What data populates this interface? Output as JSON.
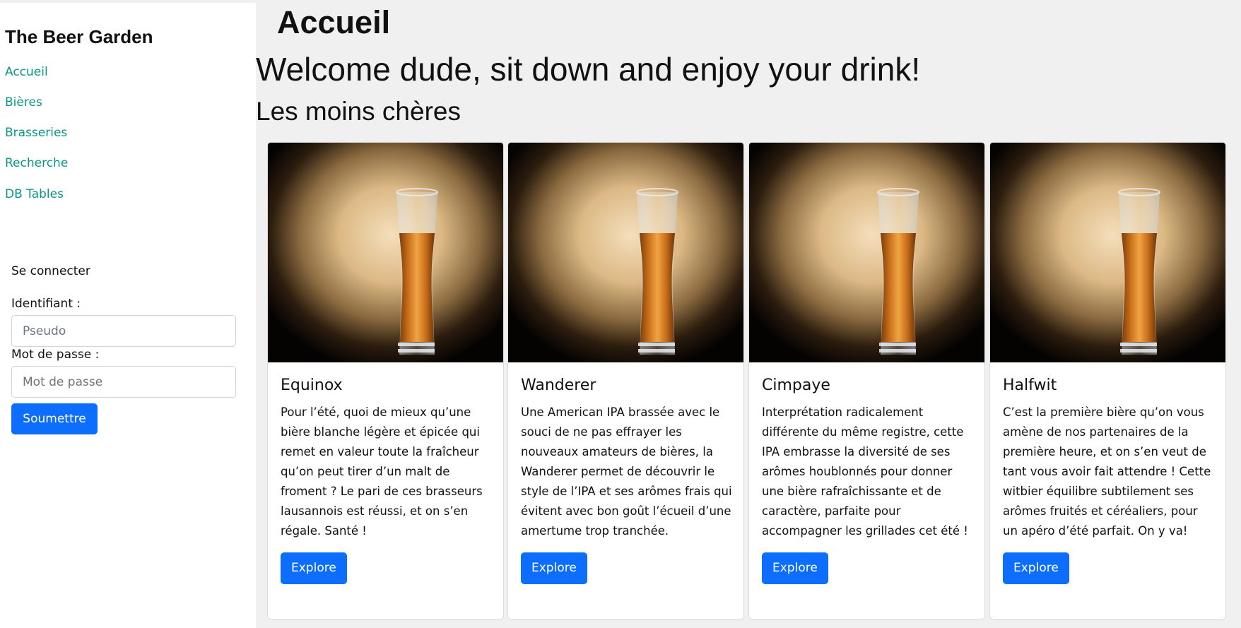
{
  "sidebar": {
    "brand": "The Beer Garden",
    "nav": [
      {
        "label": "Accueil"
      },
      {
        "label": "Bières"
      },
      {
        "label": "Brasseries"
      },
      {
        "label": "Recherche"
      },
      {
        "label": "DB Tables"
      }
    ],
    "login": {
      "title": "Se connecter",
      "username_label": "Identifiant :",
      "username_placeholder": "Pseudo",
      "password_label": "Mot de passe :",
      "password_placeholder": "Mot de passe",
      "submit_label": "Soumettre"
    }
  },
  "main": {
    "page_title": "Accueil",
    "welcome": "Welcome dude, sit down and enjoy your drink!",
    "section_title": "Les moins chères",
    "cards": [
      {
        "title": "Equinox",
        "text": "Pour l’été, quoi de mieux qu’une bière blanche légère et épicée qui remet en valeur toute la fraîcheur qu’on peut tirer d’un malt de froment ? Le pari de ces brasseurs lausannois est réussi, et on s’en régale. Santé !",
        "button": "Explore"
      },
      {
        "title": "Wanderer",
        "text": "Une American IPA brassée avec le souci de ne pas effrayer les nouveaux amateurs de bières, la Wanderer permet de découvrir le style de l’IPA et ses arômes frais qui évitent avec bon goût l’écueil d’une amertume trop tranchée.",
        "button": "Explore"
      },
      {
        "title": "Cimpaye",
        "text": "Interprétation radicalement différente du même registre, cette IPA embrasse la diversité de ses arômes houblonnés pour donner une bière rafraîchissante et de caractère, parfaite pour accompagner les grillades cet été !",
        "button": "Explore"
      },
      {
        "title": "Halfwit",
        "text": "C’est la première bière qu’on vous amène de nos partenaires de la première heure, et on s’en veut de tant vous avoir fait attendre ! Cette witbier équilibre subtilement ses arômes fruités et céréaliers, pour un apéro d’été parfait. On y va!",
        "button": "Explore"
      }
    ]
  },
  "colors": {
    "link": "#0d9488",
    "primary_button": "#0d6efd",
    "page_background": "#f0f0f0",
    "sidebar_background": "#ffffff"
  }
}
